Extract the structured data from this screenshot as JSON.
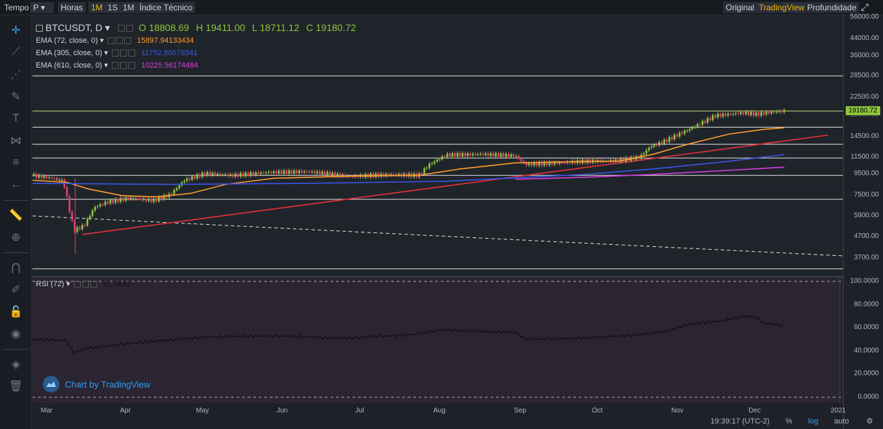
{
  "topbar": {
    "items": [
      {
        "label": "Tempo"
      },
      {
        "label": "P ▾"
      },
      {
        "label": "Horas ▾"
      },
      {
        "label": "1M"
      },
      {
        "label": "1S"
      },
      {
        "label": "1M"
      },
      {
        "label": "Índice Técnico"
      }
    ],
    "views": [
      {
        "label": "Original"
      },
      {
        "label": "TradingView"
      },
      {
        "label": "Profundidade"
      }
    ]
  },
  "legend": {
    "symbol": "BTCUSDT, D",
    "open": "O 18808.69",
    "high": "H 19411.00",
    "low": "L 18711.12",
    "close": "C 19180.72",
    "ema1_label": "EMA (72, close, 0)",
    "ema1_value": "15897.94133434",
    "ema2_label": "EMA (305, close, 0)",
    "ema2_value": "11752.86578341",
    "ema3_label": "EMA (610, close, 0)",
    "ema3_value": "10225.56174484",
    "rsi_label": "RSI (72)",
    "rsi_value": "61.8632"
  },
  "price_axis": {
    "ticks": [
      "56000.00",
      "44000.00",
      "36000.00",
      "28500.00",
      "22500.00",
      "18000.00",
      "14500.00",
      "11500.00",
      "9500.00",
      "7500.00",
      "5900.00",
      "4700.00",
      "3700.00"
    ],
    "last_price": "19180.72"
  },
  "rsi_axis": {
    "ticks": [
      "100.0000",
      "80.0000",
      "60.0000",
      "40.0000",
      "20.0000",
      "0.0000"
    ]
  },
  "time_axis": {
    "months": [
      "Mar",
      "Apr",
      "May",
      "Jun",
      "Jul",
      "Aug",
      "Sep",
      "Oct",
      "Nov",
      "Dec",
      "2021"
    ]
  },
  "status": {
    "clock": "19:39:17 (UTC-2)",
    "percent": "%",
    "log": "log",
    "auto": "auto"
  },
  "watermark": "Chart by TradingView",
  "colors": {
    "ema72": "#ff9d2f",
    "ema305": "#3a55e8",
    "ema610": "#d63ee0",
    "trend": "#e8323a",
    "up": "#8cc63e",
    "down": "#e2426b",
    "accent": "#f0b90b"
  },
  "chart_data": {
    "type": "line",
    "scale": "log",
    "series": [
      {
        "name": "EMA (72, close, 0)",
        "last": 15897.94
      },
      {
        "name": "EMA (305, close, 0)",
        "last": 11752.87
      },
      {
        "name": "EMA (610, close, 0)",
        "last": 10225.56
      }
    ],
    "ohlc_last": {
      "open": 18808.69,
      "high": 19411.0,
      "low": 18711.12,
      "close": 19180.72
    },
    "horizontal_levels": [
      28500,
      19180.72,
      16000,
      13200,
      11300,
      9300,
      7100,
      3250
    ],
    "rsi_last": 61.8632
  }
}
